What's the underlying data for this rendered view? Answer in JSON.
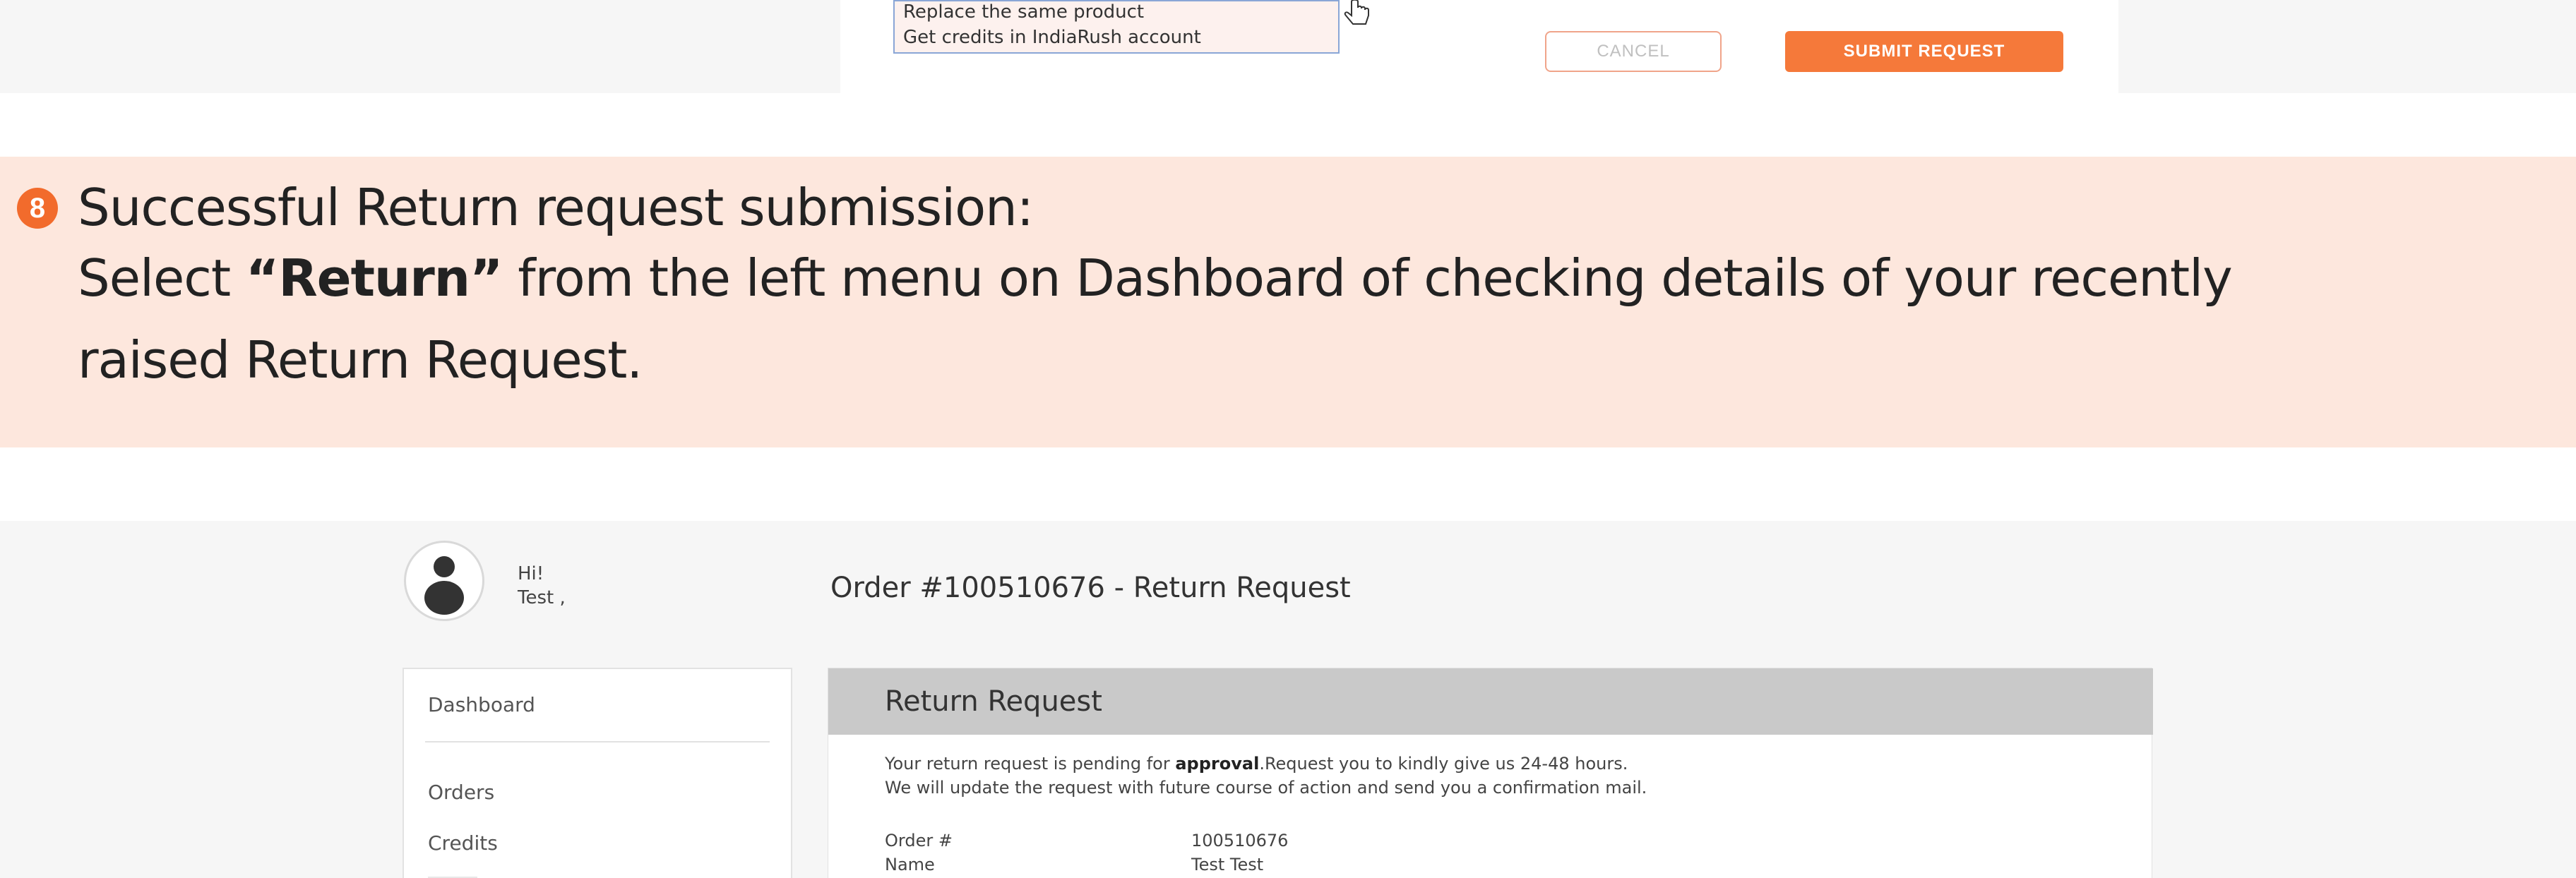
{
  "top_form": {
    "dropdown_options": [
      "Replace the same product",
      "Get credits in IndiaRush account"
    ],
    "cancel_label": "CANCEL",
    "submit_label": "SUBMIT REQUEST"
  },
  "step": {
    "number": "8",
    "line1": "Successful Return request submission:",
    "line2_pre": "Select ",
    "line2_quote_open": "“",
    "line2_bold": "Return",
    "line2_quote_close": "”",
    "line2_post": " from the left menu on Dashboard of checking details of your recently",
    "line3": "raised Return Request."
  },
  "account": {
    "greeting_hi": "Hi!",
    "greeting_name": "Test ,",
    "page_title": "Order #100510676 - Return Request",
    "sidebar": {
      "items": [
        "Dashboard",
        "Orders",
        "Credits"
      ]
    },
    "panel": {
      "title": "Return Request",
      "message_pre": "Your return request is pending for ",
      "message_bold": "approval",
      "message_post": ".Request you to kindly give us 24-48 hours.",
      "message_line2": "We will update the request with future course of action and send you a confirmation mail.",
      "details": [
        {
          "label": "Order #",
          "value": "100510676"
        },
        {
          "label": "Name",
          "value": "Test Test"
        }
      ]
    }
  },
  "colors": {
    "accent": "#f26b2c",
    "submit_button": "#f5793a",
    "banner_bg": "#fde7dd",
    "panel_header": "#c9c9c9"
  },
  "icons": [
    "hand-pointer-icon",
    "user-avatar-icon"
  ]
}
